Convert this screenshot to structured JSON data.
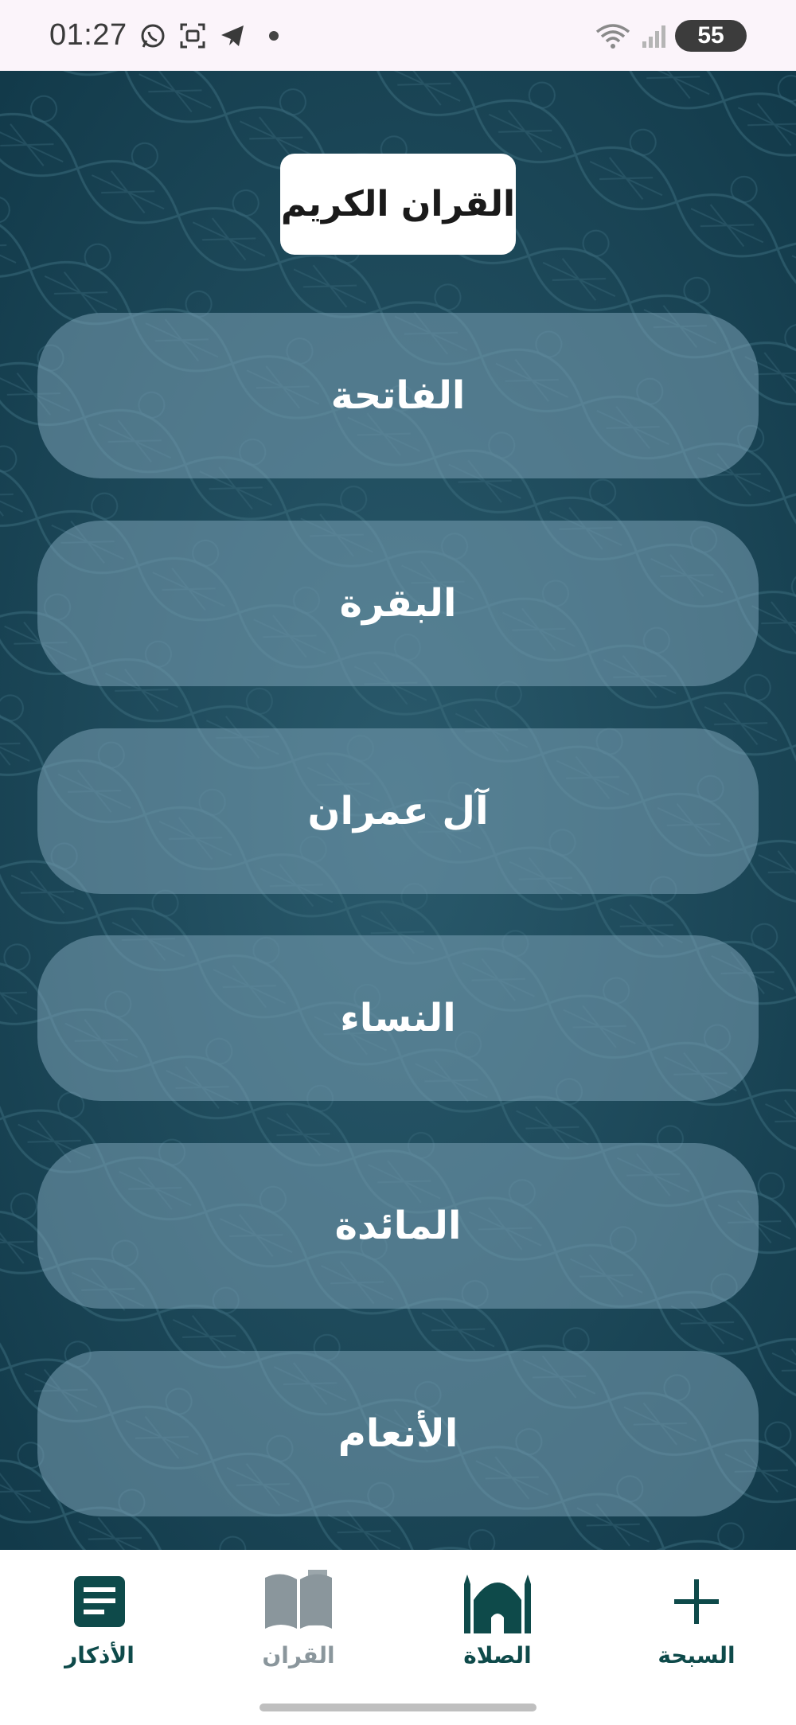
{
  "status_bar": {
    "time": "01:27",
    "battery": "55",
    "icons": [
      "whatsapp-icon",
      "screenshot-icon",
      "telegram-icon",
      "notification-dot",
      "wifi-icon",
      "signal-icon",
      "battery-icon"
    ]
  },
  "header": {
    "title": "القران الكريم"
  },
  "surahs": [
    {
      "label": "الفاتحة"
    },
    {
      "label": "البقرة"
    },
    {
      "label": "آل عمران"
    },
    {
      "label": "النساء"
    },
    {
      "label": "المائدة"
    },
    {
      "label": "الأنعام"
    }
  ],
  "bottom_nav": {
    "items": [
      {
        "label": "الأذكار",
        "icon": "document-icon",
        "active": false
      },
      {
        "label": "القران",
        "icon": "open-book-icon",
        "active": true
      },
      {
        "label": "الصلاة",
        "icon": "mosque-icon",
        "active": false
      },
      {
        "label": "السبحة",
        "icon": "plus-icon",
        "active": false
      }
    ]
  },
  "colors": {
    "background_pattern": "#1d4a5c",
    "button_fill": "#7aa0b4",
    "nav_active": "#8a969c",
    "nav_default": "#0e4a4a"
  }
}
